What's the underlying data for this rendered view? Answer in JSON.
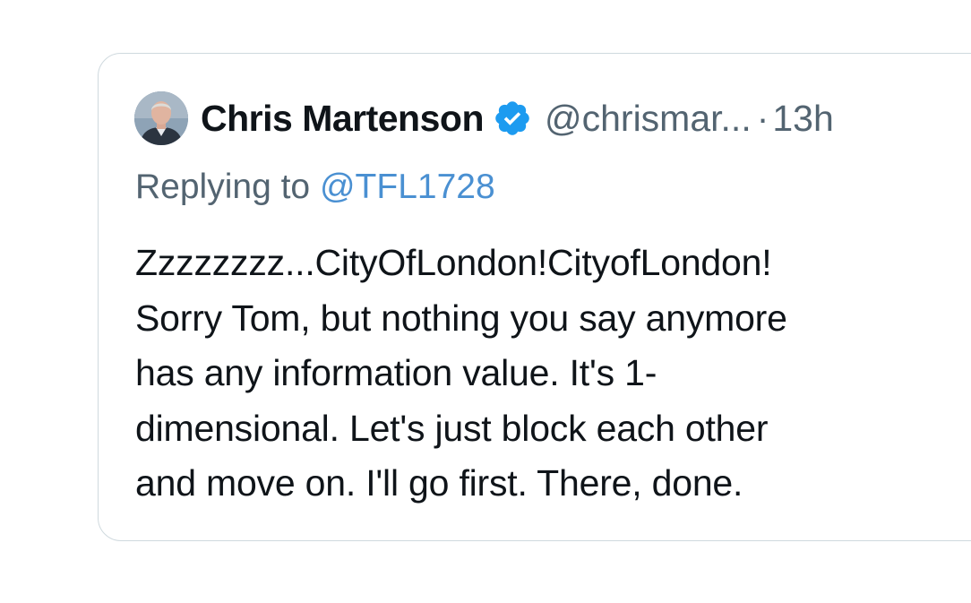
{
  "tweet": {
    "author": {
      "avatar_icon": "profile-photo",
      "display_name": "Chris Martenson",
      "verified_icon": "verified-badge-icon",
      "verified_color": "#1d9bf0",
      "handle": "@chrismar...",
      "separator": "·",
      "timestamp": "13h"
    },
    "reply": {
      "prefix": "Replying to ",
      "mention": "@TFL1728"
    },
    "text": "Zzzzzzzz...CityOfLondon!CityofLondon!\nSorry Tom, but nothing you say anymore\nhas any information value.   It's 1-\ndimensional.  Let's just block each other\nand move on.  I'll go first.  There, done."
  }
}
